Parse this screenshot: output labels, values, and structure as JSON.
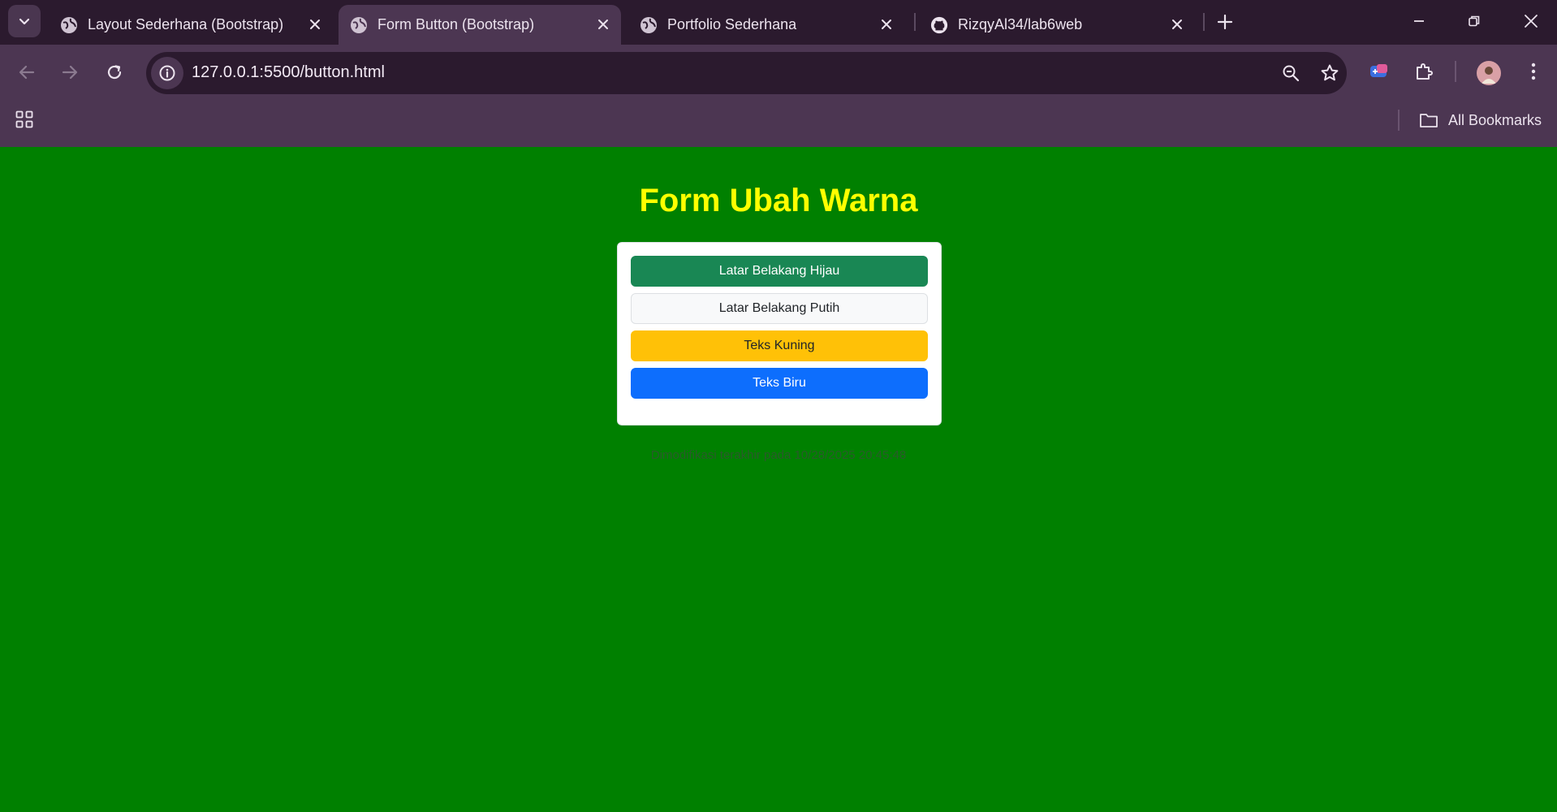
{
  "browser": {
    "tabs": [
      {
        "title": "Layout Sederhana (Bootstrap)",
        "favicon": "globe-icon",
        "active": false
      },
      {
        "title": "Form Button (Bootstrap)",
        "favicon": "globe-icon",
        "active": true
      },
      {
        "title": "Portfolio Sederhana",
        "favicon": "globe-icon",
        "active": false
      },
      {
        "title": "RizqyAl34/lab6web",
        "favicon": "github-icon",
        "active": false
      }
    ],
    "url": "127.0.0.1:5500/button.html",
    "bookmarks_label": "All Bookmarks"
  },
  "page": {
    "title": "Form Ubah Warna",
    "buttons": [
      {
        "label": "Latar Belakang Hijau",
        "variant": "success"
      },
      {
        "label": "Latar Belakang Putih",
        "variant": "light"
      },
      {
        "label": "Teks Kuning",
        "variant": "warning"
      },
      {
        "label": "Teks Biru",
        "variant": "primary"
      }
    ],
    "footer": "Dimodifikasi terakhir pada 10/28/2025 20:45:48"
  },
  "colors": {
    "page_background": "#008000",
    "title_color": "#ffff00",
    "chrome_dark": "#2b1a2e",
    "chrome_active": "#4c3652",
    "btn_success": "#198754",
    "btn_light": "#f8f9fa",
    "btn_warning": "#ffc107",
    "btn_primary": "#0d6efd"
  }
}
